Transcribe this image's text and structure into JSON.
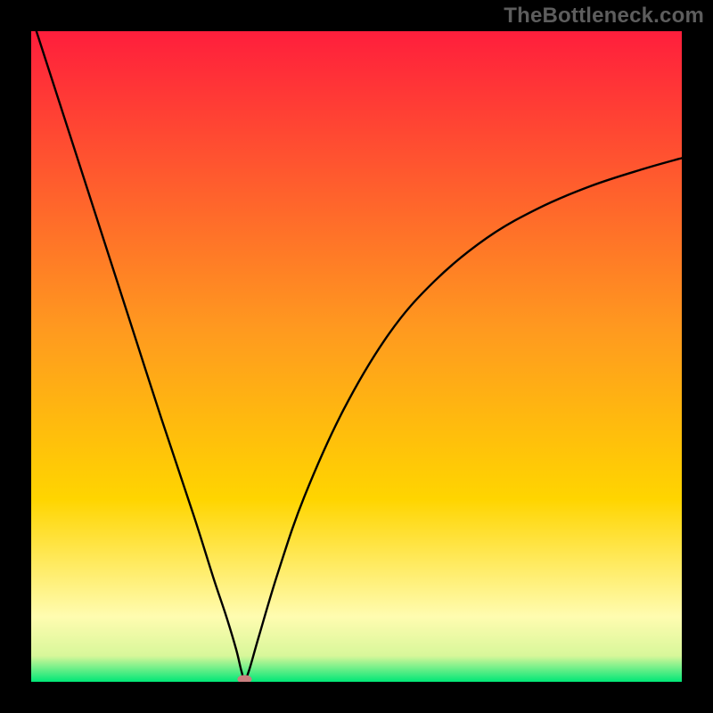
{
  "watermark": "TheBottleneck.com",
  "chart_data": {
    "type": "line",
    "title": "",
    "xlabel": "",
    "ylabel": "",
    "xlim": [
      0,
      100
    ],
    "ylim": [
      0,
      100
    ],
    "grid": false,
    "legend": false,
    "background_gradient": {
      "top_color": "#ff1e3c",
      "mid_color": "#ffd500",
      "near_bottom_color": "#fffcb0",
      "bottom_color": "#00e777"
    },
    "series": [
      {
        "name": "bottleneck-curve",
        "color": "#000000",
        "x": [
          0.8,
          5,
          10,
          15,
          20,
          25,
          28,
          30,
          31.5,
          32.3,
          32.8,
          33.5,
          35,
          38,
          42,
          48,
          55,
          62,
          70,
          78,
          86,
          94,
          100
        ],
        "y": [
          100,
          87,
          71.5,
          56,
          40.5,
          25.5,
          16,
          10,
          5,
          1.7,
          0.4,
          1.8,
          7,
          17,
          28.5,
          41.8,
          53.5,
          61.6,
          68.2,
          72.8,
          76.2,
          78.8,
          80.5
        ]
      }
    ],
    "marker": {
      "name": "min-point",
      "x": 32.8,
      "y": 0.4,
      "color": "#c97f7f",
      "rx": 1.1,
      "ry": 0.65
    }
  }
}
